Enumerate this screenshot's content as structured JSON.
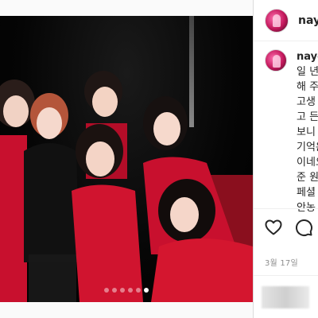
{
  "post": {
    "username": "nayeo",
    "caption_lines": [
      "일 년",
      "해 주",
      "고생",
      "고 든",
      "보니 I",
      "기억은",
      "이네오",
      "준 원.",
      "페셜 -",
      "안농 -"
    ],
    "date": "3월 17일",
    "carousel": {
      "total": 6,
      "active_index": 5
    }
  },
  "icons": {
    "like": "heart-icon",
    "comment": "speech-bubble-icon"
  }
}
